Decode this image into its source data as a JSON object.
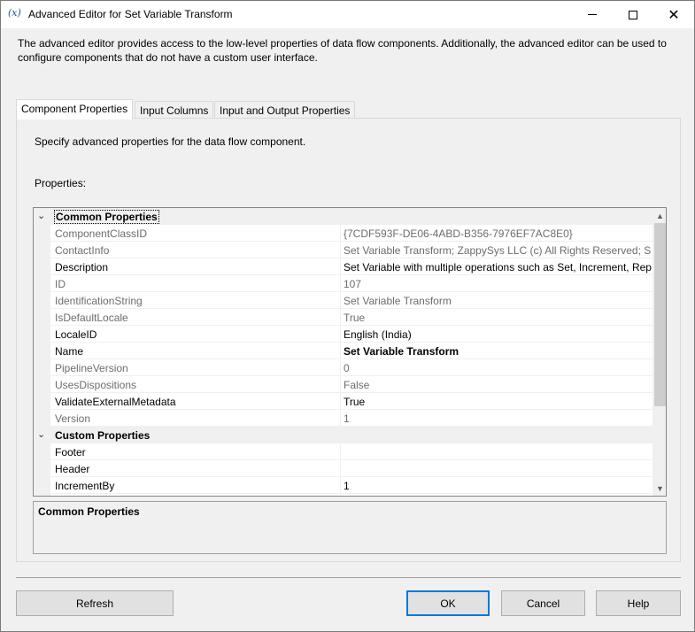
{
  "window": {
    "title": "Advanced Editor for Set Variable Transform",
    "icon_label": "(x)",
    "minimize_icon": "minimize-icon",
    "maximize_icon": "maximize-icon",
    "close_glyph": "✕"
  },
  "description": "The advanced editor provides access to the low-level properties of data flow components. Additionally, the advanced editor can be used to configure components that do not have a custom user interface.",
  "tabs": [
    {
      "label": "Component Properties",
      "active": true
    },
    {
      "label": "Input Columns",
      "active": false
    },
    {
      "label": "Input and Output Properties",
      "active": false
    }
  ],
  "panel": {
    "instruction": "Specify advanced properties for the data flow component.",
    "properties_label": "Properties:"
  },
  "grid": {
    "categories": [
      {
        "name": "Common Properties",
        "properties": [
          {
            "name": "ComponentClassID",
            "value": "{7CDF593F-DE06-4ABD-B356-7976EF7AC8E0}",
            "readonly": true
          },
          {
            "name": "ContactInfo",
            "value": "Set Variable Transform; ZappySys LLC (c) All Rights Reserved; SSIS I",
            "readonly": true
          },
          {
            "name": "Description",
            "value": "Set Variable with multiple operations such as Set, Increment, Repla",
            "readonly": false
          },
          {
            "name": "ID",
            "value": "107",
            "readonly": true
          },
          {
            "name": "IdentificationString",
            "value": "Set Variable Transform",
            "readonly": true
          },
          {
            "name": "IsDefaultLocale",
            "value": "True",
            "readonly": true
          },
          {
            "name": "LocaleID",
            "value": "English (India)",
            "readonly": false
          },
          {
            "name": "Name",
            "value": "Set Variable Transform",
            "readonly": false,
            "bold": true
          },
          {
            "name": "PipelineVersion",
            "value": "0",
            "readonly": true
          },
          {
            "name": "UsesDispositions",
            "value": "False",
            "readonly": true
          },
          {
            "name": "ValidateExternalMetadata",
            "value": "True",
            "readonly": false
          },
          {
            "name": "Version",
            "value": "1",
            "readonly": true
          }
        ]
      },
      {
        "name": "Custom Properties",
        "properties": [
          {
            "name": "Footer",
            "value": "",
            "readonly": false
          },
          {
            "name": "Header",
            "value": "",
            "readonly": false
          },
          {
            "name": "IncrementBy",
            "value": "1",
            "readonly": false
          }
        ]
      }
    ]
  },
  "help": {
    "title": "Common Properties"
  },
  "buttons": {
    "refresh": "Refresh",
    "ok": "OK",
    "cancel": "Cancel",
    "help": "Help"
  },
  "colors": {
    "accent": "#0078d7",
    "readonly_text": "#6d6d6d",
    "dialog_bg": "#f0f0f0"
  }
}
